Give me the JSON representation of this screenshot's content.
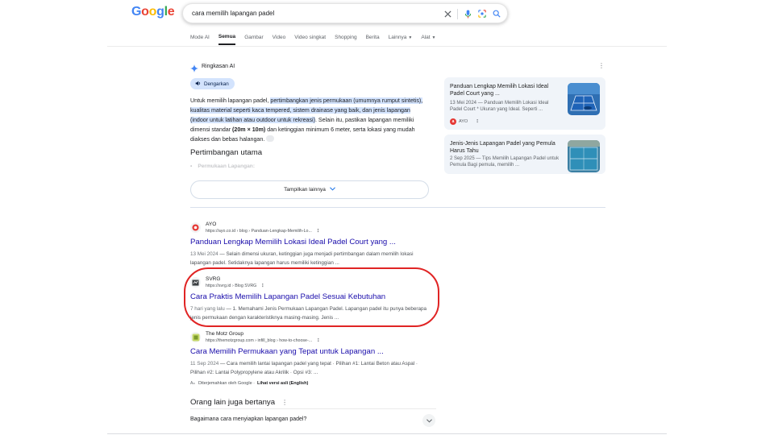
{
  "header": {
    "logo_letters": [
      "G",
      "o",
      "o",
      "g",
      "l",
      "e"
    ],
    "search_query": "cara memilih lapangan padel",
    "icons": [
      "close-icon",
      "mic-icon",
      "lens-icon",
      "search-icon"
    ]
  },
  "tabs": [
    {
      "label": "Mode AI",
      "active": false
    },
    {
      "label": "Semua",
      "active": true
    },
    {
      "label": "Gambar",
      "active": false
    },
    {
      "label": "Video",
      "active": false
    },
    {
      "label": "Video singkat",
      "active": false
    },
    {
      "label": "Shopping",
      "active": false
    },
    {
      "label": "Berita",
      "active": false
    },
    {
      "label": "Lainnya",
      "active": false,
      "dropdown": true
    },
    {
      "label": "Alat",
      "active": false,
      "dropdown": true
    }
  ],
  "ai_overview": {
    "title": "Ringkasan AI",
    "listen_label": "Dengarkan",
    "body_pre": "Untuk memilih lapangan padel, ",
    "body_highlight": "pertimbangkan jenis permukaan (umumnya rumput sintetis), kualitas material seperti kaca tempered, sistem drainase yang baik, dan jenis lapangan (indoor untuk latihan atau outdoor untuk rekreasi)",
    "body_post_1": ". Selain itu, pastikan lapangan memiliki dimensi standar ",
    "dimension": "(20m × 10m)",
    "body_post_2": " dan ketinggian minimum 6 meter, serta lokasi yang mudah diakses dan bebas halangan.",
    "subheading": "Pertimbangan utama",
    "faded_item": "Permukaan Lapangan:",
    "show_more_label": "Tampilkan lainnya",
    "sources": [
      {
        "title": "Panduan Lengkap Memilih Lokasi Ideal Padel Court yang ...",
        "snippet": "13 Mei 2024 — Panduan Memilih Lokasi Ideal Padel Court * Ukuran yang Ideal. Seperti ...",
        "site": "AYO"
      },
      {
        "title": "Jenis-Jenis Lapangan Padel yang Pemula Harus Tahu",
        "snippet": "2 Sep 2025 — Tips Memilih Lapangan Padel untuk Pemula Bagi pemula, memilih ..."
      }
    ]
  },
  "results": [
    {
      "site": "AYO",
      "url": "https://ayo.co.id › blog › Panduan-Lengkap-Memilih-Lo...",
      "title": "Panduan Lengkap Memilih Lokasi Ideal Padel Court yang ...",
      "date": "13 Mei 2024",
      "snippet": " — Selain dimensi ukuran, ketinggian juga menjadi pertimbangan dalam memilih lokasi lapangan padel. Setidaknya lapangan harus memiliki ketinggian ..."
    },
    {
      "site": "SVRG",
      "url": "https://svrg.id › Blog SVRG",
      "title": "Cara Praktis Memilih Lapangan Padel Sesuai Kebutuhan",
      "date": "7 hari yang lalu",
      "snippet": " — 1. Memahami Jenis Permukaan Lapangan Padel. Lapangan padel itu punya beberapa jenis permukaan dengan karakteristiknya masing-masing. Jenis ..."
    },
    {
      "site": "The Motz Group",
      "url": "https://themotzgroup.com › infill_blog › how-to-choose-...",
      "title": "Cara Memilih Permukaan yang Tepat untuk Lapangan ...",
      "date": "11 Sep 2024",
      "snippet": " — Cara memilih lantai lapangan padel yang tepat · Pilihan #1: Lantai Beton atau Aspal · Pilihan #2: Lantai Polypropylene atau Akrilik · Opsi #3: ..."
    }
  ],
  "translation_note": {
    "text": "Diterjemahkan oleh Google ·",
    "link": "Lihat versi asli (English)"
  },
  "paa": {
    "title": "Orang lain juga bertanya",
    "question": "Bagaimana cara menyiapkan lapangan padel?"
  },
  "colors": {
    "link": "#1a0dab",
    "highlight": "#d3e3fd",
    "annotation_ring": "#e02424"
  }
}
